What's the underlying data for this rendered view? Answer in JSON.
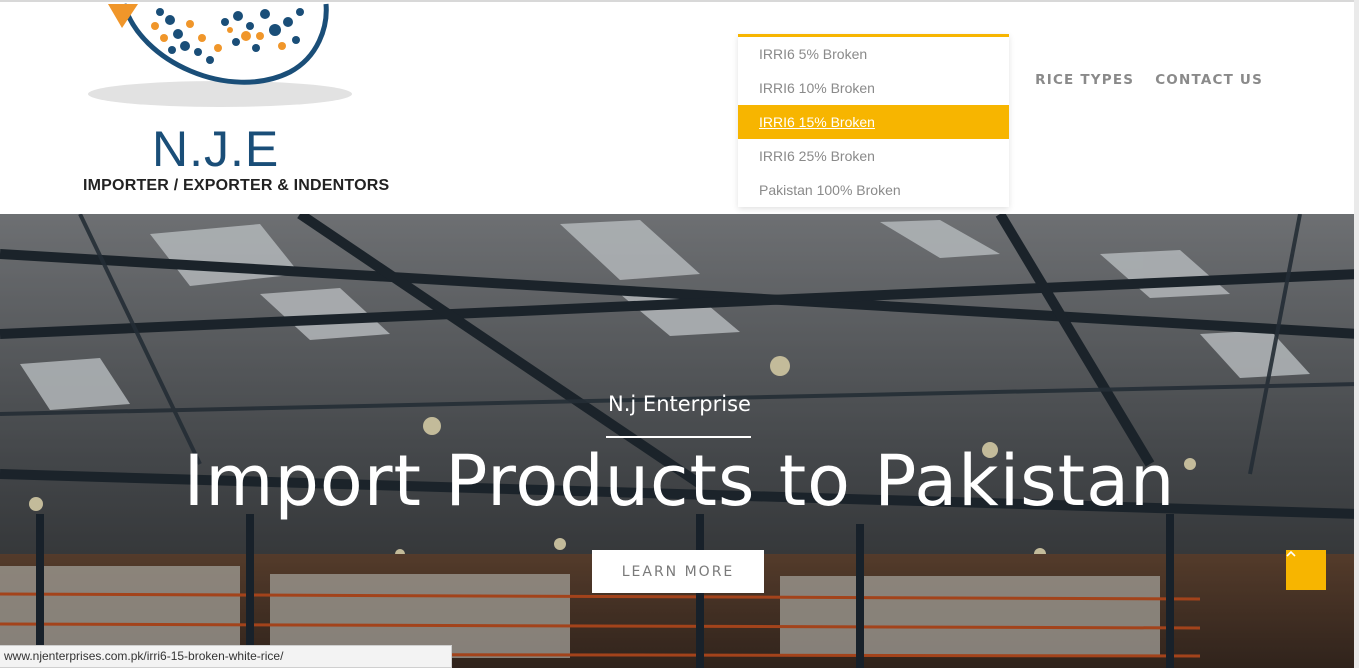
{
  "logo": {
    "title": "N.J.E",
    "subtitle": "IMPORTER / EXPORTER & INDENTORS"
  },
  "nav": {
    "items": [
      {
        "label": "RICE TYPES"
      },
      {
        "label": "CONTACT US"
      }
    ]
  },
  "dropdown": {
    "items": [
      {
        "label": "IRRI6 5% Broken"
      },
      {
        "label": "IRRI6 10% Broken"
      },
      {
        "label": "IRRI6 15% Broken"
      },
      {
        "label": "IRRI6 25% Broken"
      },
      {
        "label": "Pakistan 100% Broken"
      }
    ],
    "active_index": 2
  },
  "hero": {
    "eyebrow": "N.j Enterprise",
    "headline": "Import Products to Pakistan",
    "cta_label": "LEARN MORE"
  },
  "status_bar": {
    "url": "www.njenterprises.com.pk/irri6-15-broken-white-rice/"
  },
  "colors": {
    "accent": "#f7b500",
    "logo_blue": "#1a4e78",
    "logo_orange": "#f0962a",
    "nav_text": "#8a8a8a"
  },
  "icons": {
    "scroll_top": "chevron-up-icon"
  }
}
